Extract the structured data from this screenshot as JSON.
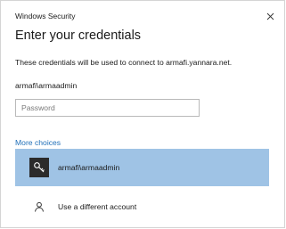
{
  "window": {
    "title": "Windows Security",
    "close_glyph": "×"
  },
  "heading": "Enter your credentials",
  "description": "These credentials will be used to connect to armafi.yannara.net.",
  "username": "armafi\\armaadmin",
  "password": {
    "placeholder": "Password",
    "value": ""
  },
  "more_choices": "More choices",
  "options": [
    {
      "label": "armafi\\armaadmin",
      "icon": "key-icon",
      "selected": true
    },
    {
      "label": "Use a different account",
      "icon": "person-icon",
      "selected": false
    }
  ],
  "colors": {
    "selected_bg": "#9fc3e5",
    "link": "#1f6fb8"
  }
}
